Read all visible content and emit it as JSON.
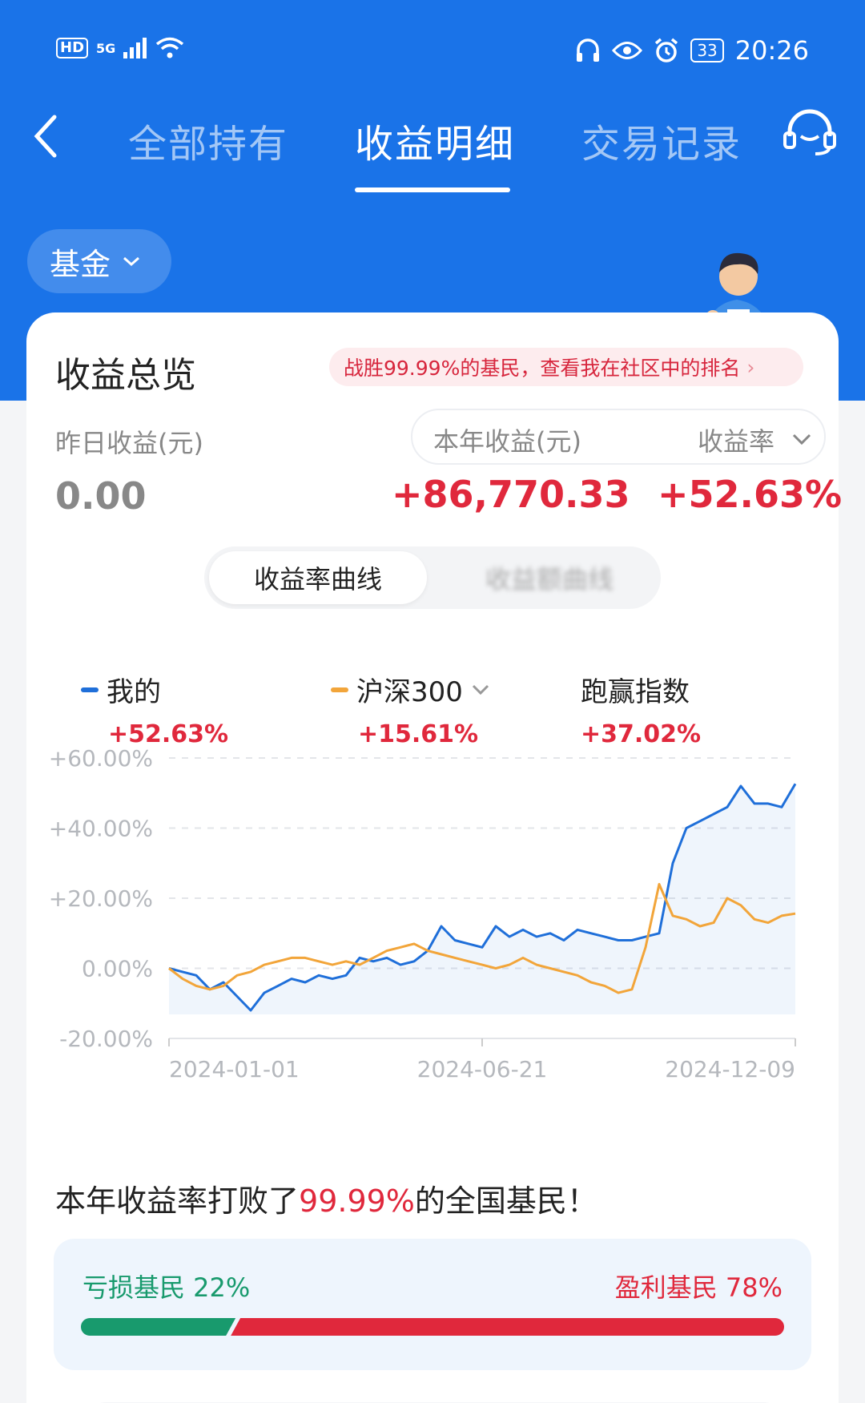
{
  "status_bar": {
    "hd": "HD",
    "network": "5G",
    "battery": "33",
    "time": "20:26"
  },
  "nav": {
    "tabs": [
      "全部持有",
      "收益明细",
      "交易记录"
    ],
    "active_tab": "收益明细"
  },
  "filter": {
    "label": "基金"
  },
  "overview": {
    "title": "收益总览",
    "rank_text": "战胜99.99%的基民，查看我在社区中的排名",
    "yesterday_label": "昨日收益(元)",
    "yesterday_value": "0.00",
    "year_label": "本年收益(元)",
    "rate_label": "收益率",
    "year_value": "+86,770.33",
    "rate_value": "+52.63%"
  },
  "segment": {
    "active": "收益率曲线",
    "inactive": "收益额曲线"
  },
  "legend": [
    {
      "name": "我的",
      "value": "+52.63%",
      "color": "#1f6fd9"
    },
    {
      "name": "沪深300",
      "value": "+15.61%",
      "color": "#f2a53a"
    },
    {
      "name": "跑赢指数",
      "value": "+37.02%"
    }
  ],
  "chart_data": {
    "type": "line",
    "ylim": [
      -20,
      60
    ],
    "yticks": [
      "+60.00%",
      "+40.00%",
      "+20.00%",
      "0.00%",
      "-20.00%"
    ],
    "xticks": [
      "2024-01-01",
      "2024-06-21",
      "2024-12-09"
    ],
    "series": [
      {
        "name": "我的",
        "color": "#1f6fd9",
        "values": [
          0,
          -1,
          -2,
          -6,
          -4,
          -8,
          -12,
          -7,
          -5,
          -3,
          -4,
          -2,
          -3,
          -2,
          3,
          2,
          3,
          1,
          2,
          5,
          12,
          8,
          7,
          6,
          12,
          9,
          11,
          9,
          10,
          8,
          11,
          10,
          9,
          8,
          8,
          9,
          10,
          30,
          40,
          42,
          44,
          46,
          52,
          47,
          47,
          46,
          52.63
        ]
      },
      {
        "name": "沪深300",
        "color": "#f2a53a",
        "values": [
          0,
          -3,
          -5,
          -6,
          -5,
          -2,
          -1,
          1,
          2,
          3,
          3,
          2,
          1,
          2,
          1,
          3,
          5,
          6,
          7,
          5,
          4,
          3,
          2,
          1,
          0,
          1,
          3,
          1,
          0,
          -1,
          -2,
          -4,
          -5,
          -7,
          -6,
          6,
          24,
          15,
          14,
          12,
          13,
          20,
          18,
          14,
          13,
          15,
          15.61
        ]
      }
    ]
  },
  "beat": {
    "prefix": "本年收益率打败了",
    "percent": "99.99%",
    "suffix": "的全国基民！"
  },
  "distribution": {
    "loss_label": "亏损基民 22%",
    "gain_label": "盈利基民 78%",
    "loss_pct": 22,
    "gain_pct": 78,
    "loss_color": "#189a6d",
    "gain_color": "#e0283c"
  }
}
